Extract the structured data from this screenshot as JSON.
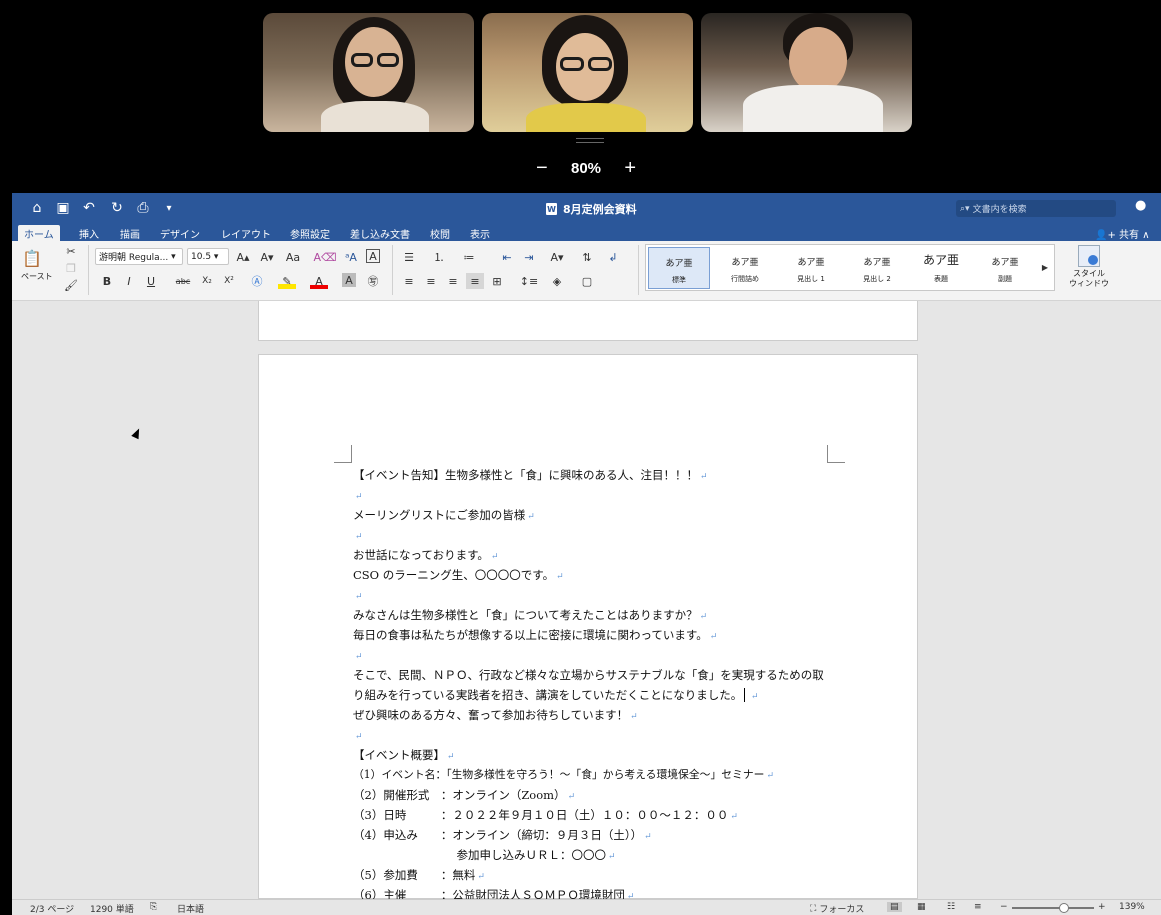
{
  "zoom_overlay": {
    "minus": "−",
    "value": "80%",
    "plus": "+"
  },
  "titlebar": {
    "doc_title": "8月定例会資料",
    "search_placeholder": "文書内を検索"
  },
  "tabs": [
    "ホーム",
    "挿入",
    "描画",
    "デザイン",
    "レイアウト",
    "参照設定",
    "差し込み文書",
    "校閲",
    "表示"
  ],
  "share_label": "共有",
  "ribbon": {
    "paste_label": "ペースト",
    "font_name": "游明朝 Regula...",
    "font_size": "10.5",
    "bold": "B",
    "italic": "I",
    "underline": "U",
    "strike": "abc",
    "sub": "X₂",
    "sup": "X²",
    "styles": [
      {
        "preview": "あア亜",
        "name": "標準"
      },
      {
        "preview": "あア亜",
        "name": "行間詰め"
      },
      {
        "preview": "あア亜",
        "name": "見出し 1"
      },
      {
        "preview": "あア亜",
        "name": "見出し 2"
      },
      {
        "preview": "あア亜",
        "name": "表題"
      },
      {
        "preview": "あア亜",
        "name": "副題"
      }
    ],
    "style_window_line1": "スタイル",
    "style_window_line2": "ウィンドウ"
  },
  "document_lines": [
    "【イベント告知】生物多様性と「食」に興味のある人、注目！！！",
    "",
    "メーリングリストにご参加の皆様",
    "",
    "お世話になっております。",
    "CSO のラーニング生、〇〇〇〇です。",
    "",
    "みなさんは生物多様性と「食」について考えたことはありますか？",
    "毎日の食事は私たちが想像する以上に密接に環境に関わっています。",
    "",
    "そこで、民間、ＮＰＯ、行政など様々な立場からサステナブルな「食」を実現するための取",
    "り組みを行っている実践者を招き、講演をしていただくことになりました。",
    "ぜひ興味のある方々、奮って参加お待ちしています！",
    "",
    "【イベント概要】",
    "（1）イベント名：「生物多様性を守ろう！～「食」から考える環境保全～」セミナー",
    "（2）開催形式　：オンライン（Zoom）",
    "（3）日時　　　：２０２２年９月１０日（土）１０：００～１２：００",
    "（4）申込み　　：オンライン（締切：９月３日（土））",
    "　　　　　　　　　参加申し込みＵＲＬ：〇〇〇",
    "（5）参加費　　：無料",
    "（6）主催　　　：公益財団法人ＳＯＭＰＯ環境財団"
  ],
  "statusbar": {
    "page": "2/3 ページ",
    "words": "1290 単語",
    "language": "日本語",
    "focus": "フォーカス",
    "zoom": "139%"
  }
}
